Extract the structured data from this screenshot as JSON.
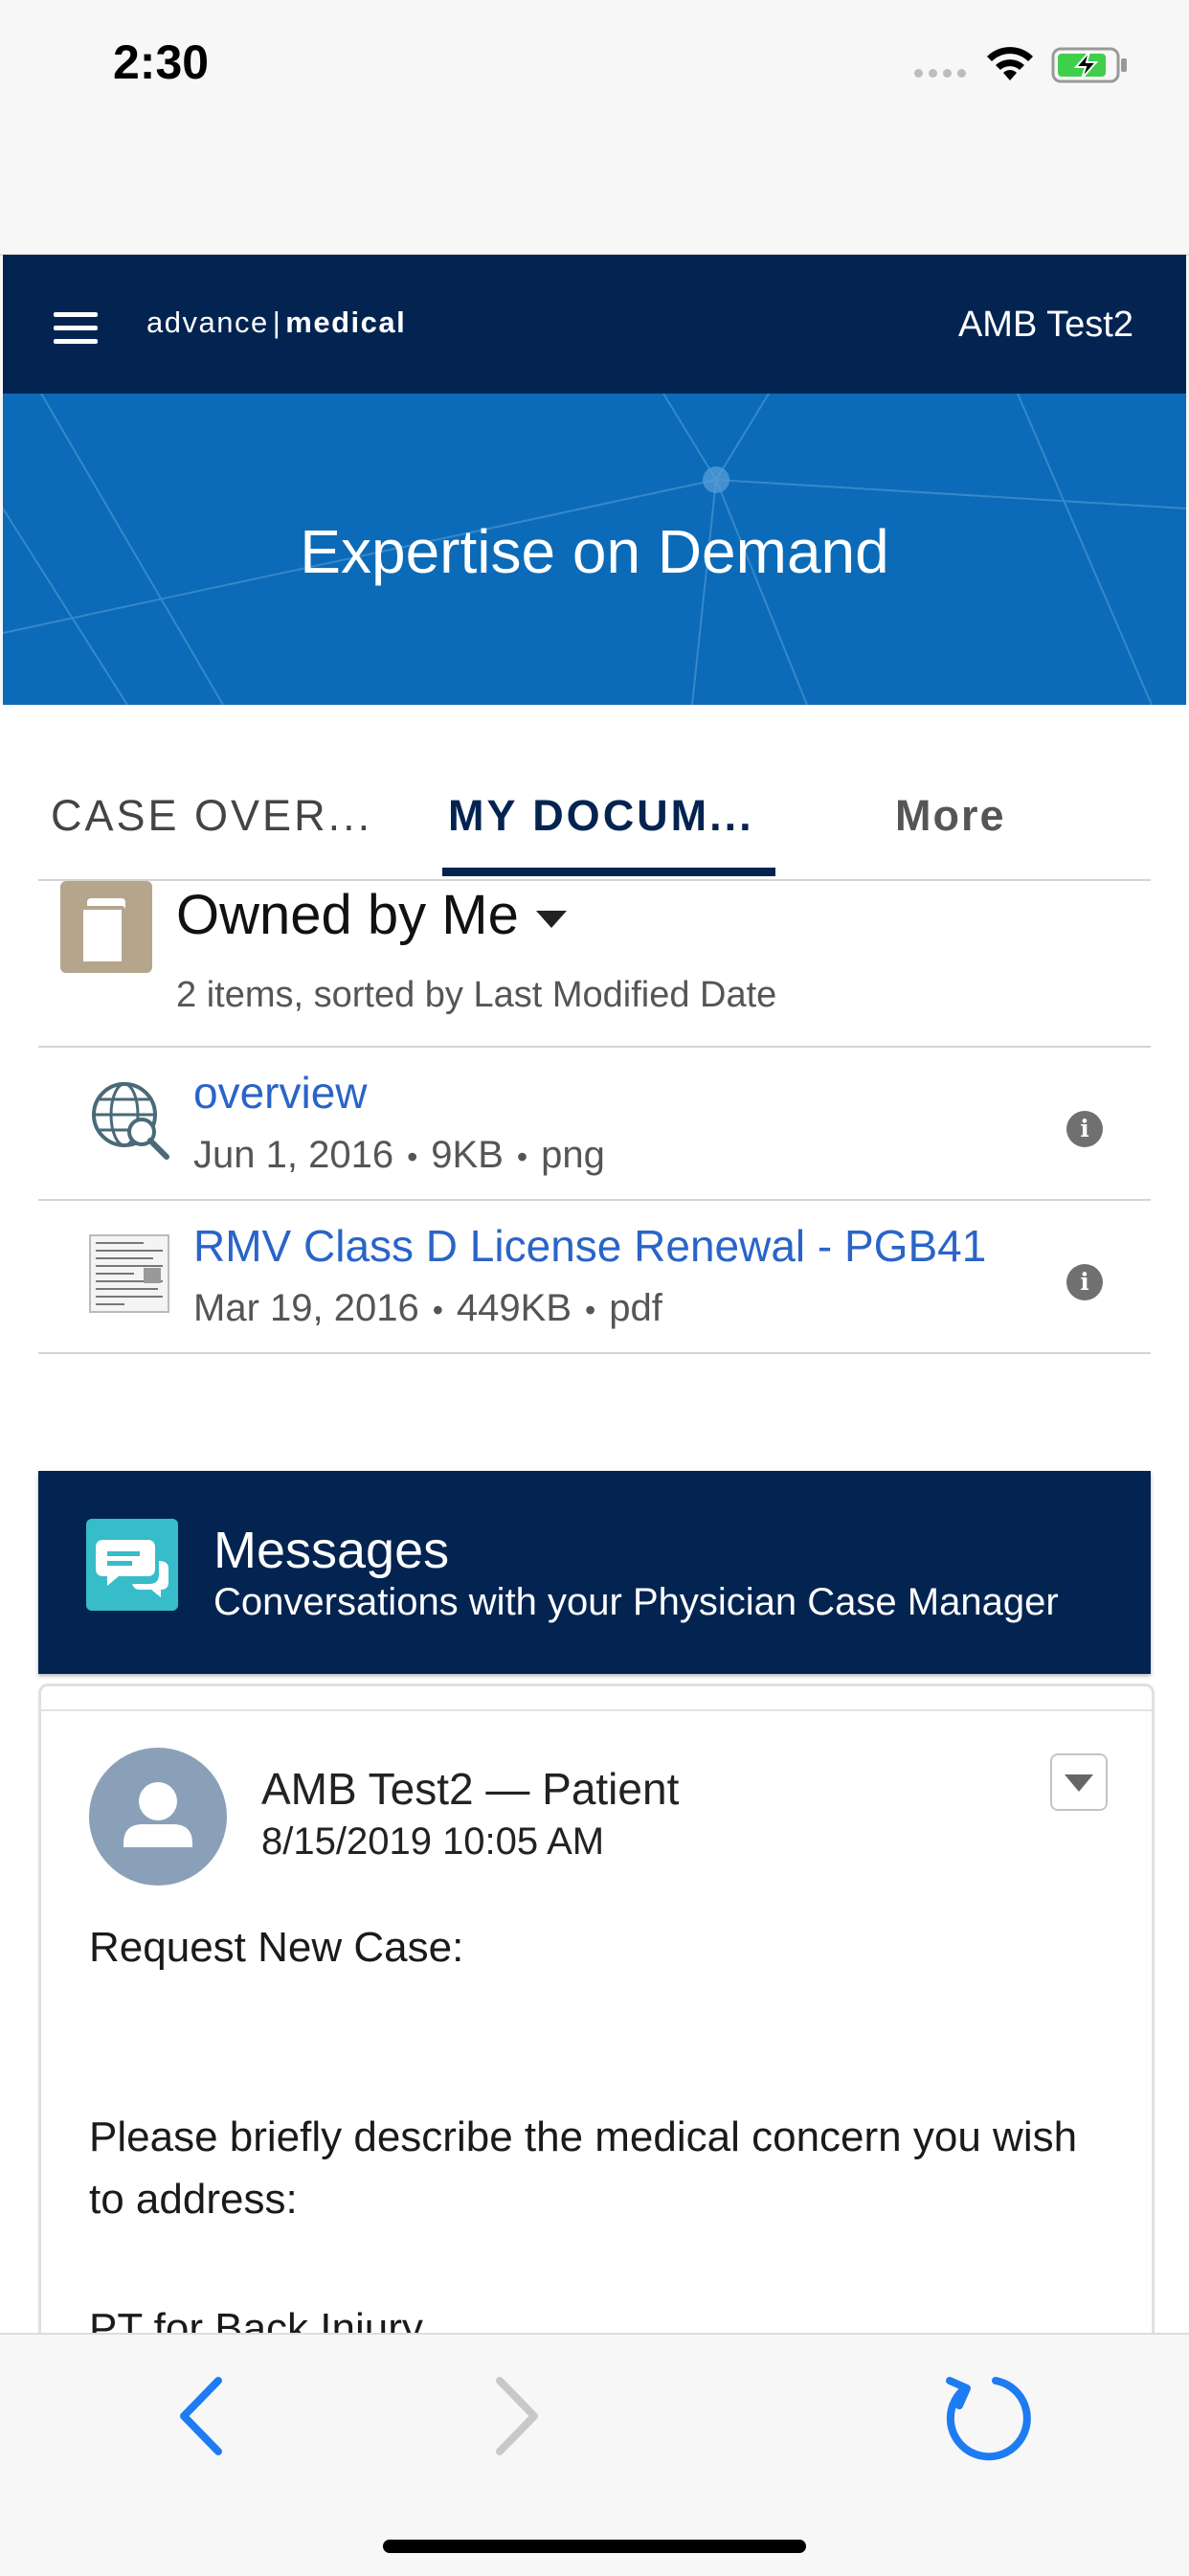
{
  "status_bar": {
    "time": "2:30"
  },
  "header": {
    "logo_left": "advance",
    "logo_right": "medical",
    "user_name": "AMB Test2"
  },
  "hero": {
    "title": "Expertise on Demand"
  },
  "tabs": [
    {
      "label": "CASE OVER...",
      "selected": false
    },
    {
      "label": "MY DOCUM...",
      "selected": true
    },
    {
      "label": "More",
      "selected": false
    }
  ],
  "documents": {
    "list_title": "Owned by Me",
    "meta": "2 items, sorted by Last Modified Date",
    "items": [
      {
        "name": "overview",
        "date": "Jun 1, 2016",
        "size": "9KB",
        "type": "png",
        "icon": "globe-search-icon"
      },
      {
        "name": "RMV Class D License Renewal - PGB41",
        "date": "Mar 19, 2016",
        "size": "449KB",
        "type": "pdf",
        "icon": "document-thumbnail"
      }
    ]
  },
  "messages": {
    "title": "Messages",
    "subtitle": "Conversations with your Physician Case Manager"
  },
  "post": {
    "author": "AMB Test2 — Patient",
    "timestamp": "8/15/2019 10:05 AM",
    "body": [
      "Request New Case:",
      "Please briefly describe the medical concern you wish to address:",
      "PT for Back Injury"
    ]
  },
  "colors": {
    "header_bg": "#032451",
    "hero_bg": "#0b6bb8",
    "link": "#2a64c8",
    "messages_icon": "#37bcc9",
    "docs_icon": "#b5a58c",
    "browser_accent": "#1e7cf2"
  }
}
